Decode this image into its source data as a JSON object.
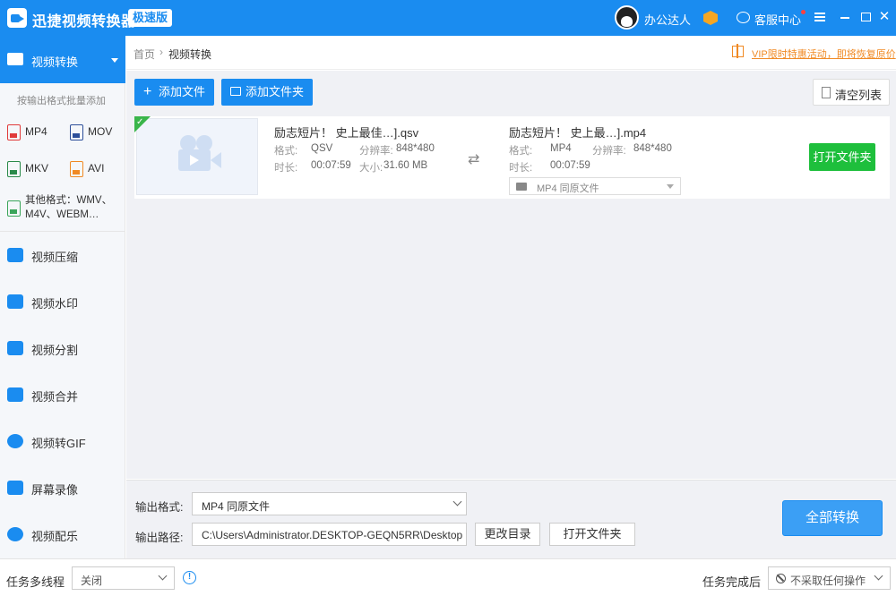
{
  "app": {
    "title": "迅捷视频转换器",
    "badge": "极速版",
    "username": "办公达人",
    "service_label": "客服中心"
  },
  "sidebar": {
    "active": {
      "label": "视频转换"
    },
    "sub_title": "按输出格式批量添加",
    "formats": [
      {
        "label": "MP4",
        "color": "#e03a3a"
      },
      {
        "label": "MOV",
        "color": "#2d4f9a"
      },
      {
        "label": "MKV",
        "color": "#2a8a4a"
      },
      {
        "label": "AVI",
        "color": "#f08a24"
      }
    ],
    "other_formats": "其他格式：WMV、M4V、WEBM…",
    "items": [
      {
        "label": "视频压缩"
      },
      {
        "label": "视频水印"
      },
      {
        "label": "视频分割"
      },
      {
        "label": "视频合并"
      },
      {
        "label": "视频转GIF"
      },
      {
        "label": "屏幕录像"
      },
      {
        "label": "视频配乐"
      }
    ]
  },
  "breadcrumb": {
    "home": "首页",
    "sep": "›",
    "current": "视频转换",
    "promo": "VIP限时特惠活动，即将恢复原价"
  },
  "toolbar": {
    "add_file": "添加文件",
    "add_folder": "添加文件夹",
    "clear_list": "清空列表"
  },
  "file": {
    "source": {
      "name": "励志短片！ 史上最佳…].qsv",
      "format_label": "格式:",
      "format": "QSV",
      "resolution_label": "分辨率:",
      "resolution": "848*480",
      "duration_label": "时长:",
      "duration": "00:07:59",
      "size_label": "大小:",
      "size": "31.60 MB"
    },
    "target": {
      "name": "励志短片！ 史上最…].mp4",
      "format_label": "格式:",
      "format": "MP4",
      "resolution_label": "分辨率:",
      "resolution": "848*480",
      "duration_label": "时长:",
      "duration": "00:07:59",
      "output_option": "MP4   同原文件"
    },
    "open_folder": "打开文件夹"
  },
  "output": {
    "format_label": "输出格式:",
    "format_value": "MP4   同原文件",
    "path_label": "输出路径:",
    "path_value": "C:\\Users\\Administrator.DESKTOP-GEQN5RR\\Desktop",
    "change_dir": "更改目录",
    "open_folder": "打开文件夹",
    "convert_all": "全部转换"
  },
  "statusbar": {
    "multithread_label": "任务多线程",
    "multithread_value": "关闭",
    "after_label": "任务完成后",
    "after_value": "不采取任何操作"
  }
}
